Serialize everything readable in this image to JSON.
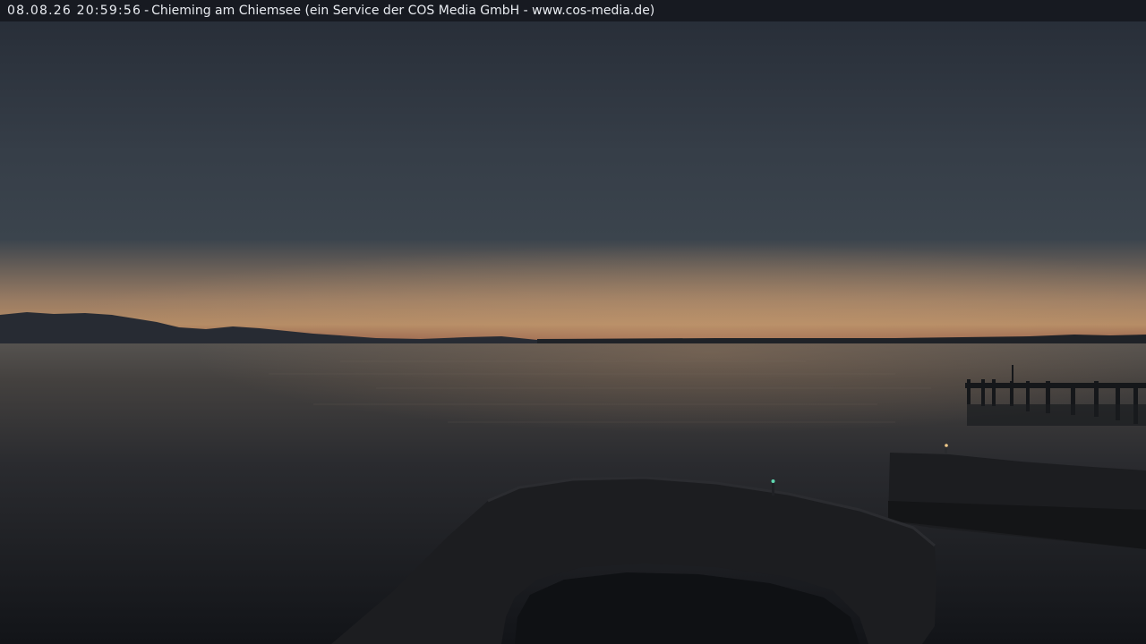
{
  "overlay": {
    "timestamp": "08.08.26 20:59:56",
    "separator": "-",
    "caption": "Chieming am Chiemsee (ein Service der COS Media GmbH - www.cos-media.de)"
  },
  "scene": {
    "colors": {
      "sky_top": "#262c36",
      "sky_mid": "#3b444d",
      "sky_horizon_glow": "#b38a64",
      "sky_horizon_red": "#8e5544",
      "mountains": "#272b33",
      "water_far": "#55524f",
      "water_mid": "#2a2b2f",
      "water_near": "#121418",
      "breakwater": "#1c1d20",
      "pier": "#15171a",
      "marker_light_green": "#5fd7b0",
      "marker_light_amber": "#f0c98a"
    }
  }
}
